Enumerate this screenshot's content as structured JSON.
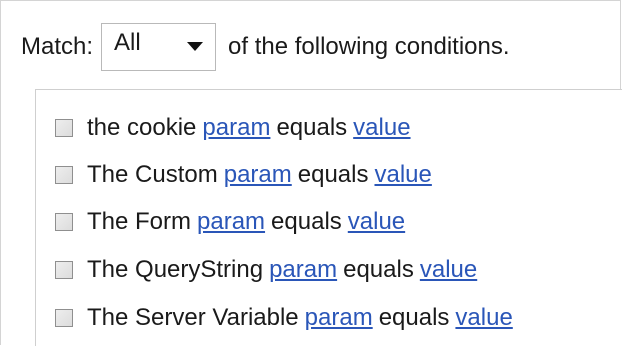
{
  "match": {
    "label": "Match:",
    "selected": "All",
    "suffix": "of the following conditions."
  },
  "conditions": [
    {
      "prefix": "the cookie",
      "param": "param",
      "operator": "equals",
      "value": "value"
    },
    {
      "prefix": "The Custom",
      "param": "param",
      "operator": "equals",
      "value": "value"
    },
    {
      "prefix": "The Form",
      "param": "param",
      "operator": "equals",
      "value": "value"
    },
    {
      "prefix": "The QueryString",
      "param": "param",
      "operator": "equals",
      "value": "value"
    },
    {
      "prefix": "The Server Variable",
      "param": "param",
      "operator": "equals",
      "value": "value"
    }
  ],
  "colors": {
    "link": "#2a56b8",
    "border": "#d4d4d4"
  }
}
